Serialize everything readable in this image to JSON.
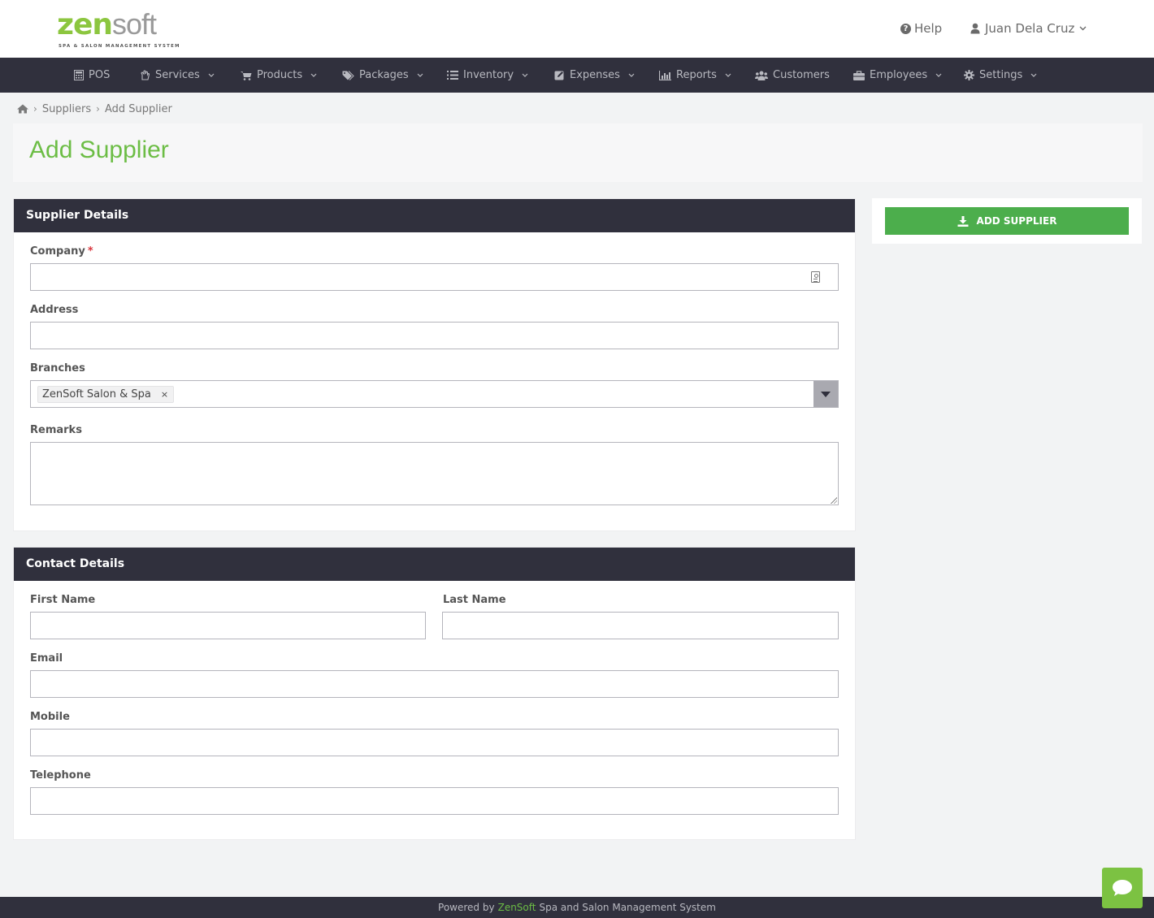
{
  "brand": {
    "logo_zen": "zen",
    "logo_soft": "soft",
    "logo_tagline": "SPA & SALON MANAGEMENT SYSTEM"
  },
  "header": {
    "help_label": "Help",
    "user_name": "Juan Dela Cruz"
  },
  "nav": {
    "items": [
      {
        "label": "POS",
        "icon": "calculator-icon",
        "dropdown": false
      },
      {
        "label": "Services",
        "icon": "hand-icon",
        "dropdown": true
      },
      {
        "label": "Products",
        "icon": "cart-icon",
        "dropdown": true
      },
      {
        "label": "Packages",
        "icon": "tags-icon",
        "dropdown": true
      },
      {
        "label": "Inventory",
        "icon": "list-icon",
        "dropdown": true
      },
      {
        "label": "Expenses",
        "icon": "edit-icon",
        "dropdown": true
      },
      {
        "label": "Reports",
        "icon": "bar-chart-icon",
        "dropdown": true
      },
      {
        "label": "Customers",
        "icon": "users-icon",
        "dropdown": false
      },
      {
        "label": "Employees",
        "icon": "briefcase-icon",
        "dropdown": true
      },
      {
        "label": "Settings",
        "icon": "gear-icon",
        "dropdown": true
      }
    ]
  },
  "breadcrumb": {
    "home_icon": "home-icon",
    "items": [
      "Suppliers",
      "Add Supplier"
    ]
  },
  "page": {
    "title": "Add Supplier"
  },
  "supplier_details": {
    "heading": "Supplier Details",
    "company_label": "Company",
    "company_required_mark": "*",
    "company_value": "",
    "address_label": "Address",
    "address_value": "",
    "branches_label": "Branches",
    "branches_selected": [
      "ZenSoft Salon & Spa"
    ],
    "branch_remove_glyph": "×",
    "remarks_label": "Remarks",
    "remarks_value": ""
  },
  "contact_details": {
    "heading": "Contact Details",
    "first_name_label": "First Name",
    "last_name_label": "Last Name",
    "email_label": "Email",
    "mobile_label": "Mobile",
    "telephone_label": "Telephone"
  },
  "actions": {
    "add_supplier_label": "ADD SUPPLIER"
  },
  "footer": {
    "prefix": "Powered by",
    "brand": "ZenSoft",
    "suffix": "Spa and Salon Management System"
  },
  "colors": {
    "nav_bg": "#30303d",
    "accent_green": "#6cbd45",
    "button_green": "#4cae4c",
    "chat_green": "#7cc242",
    "required_red": "#d9363e"
  }
}
